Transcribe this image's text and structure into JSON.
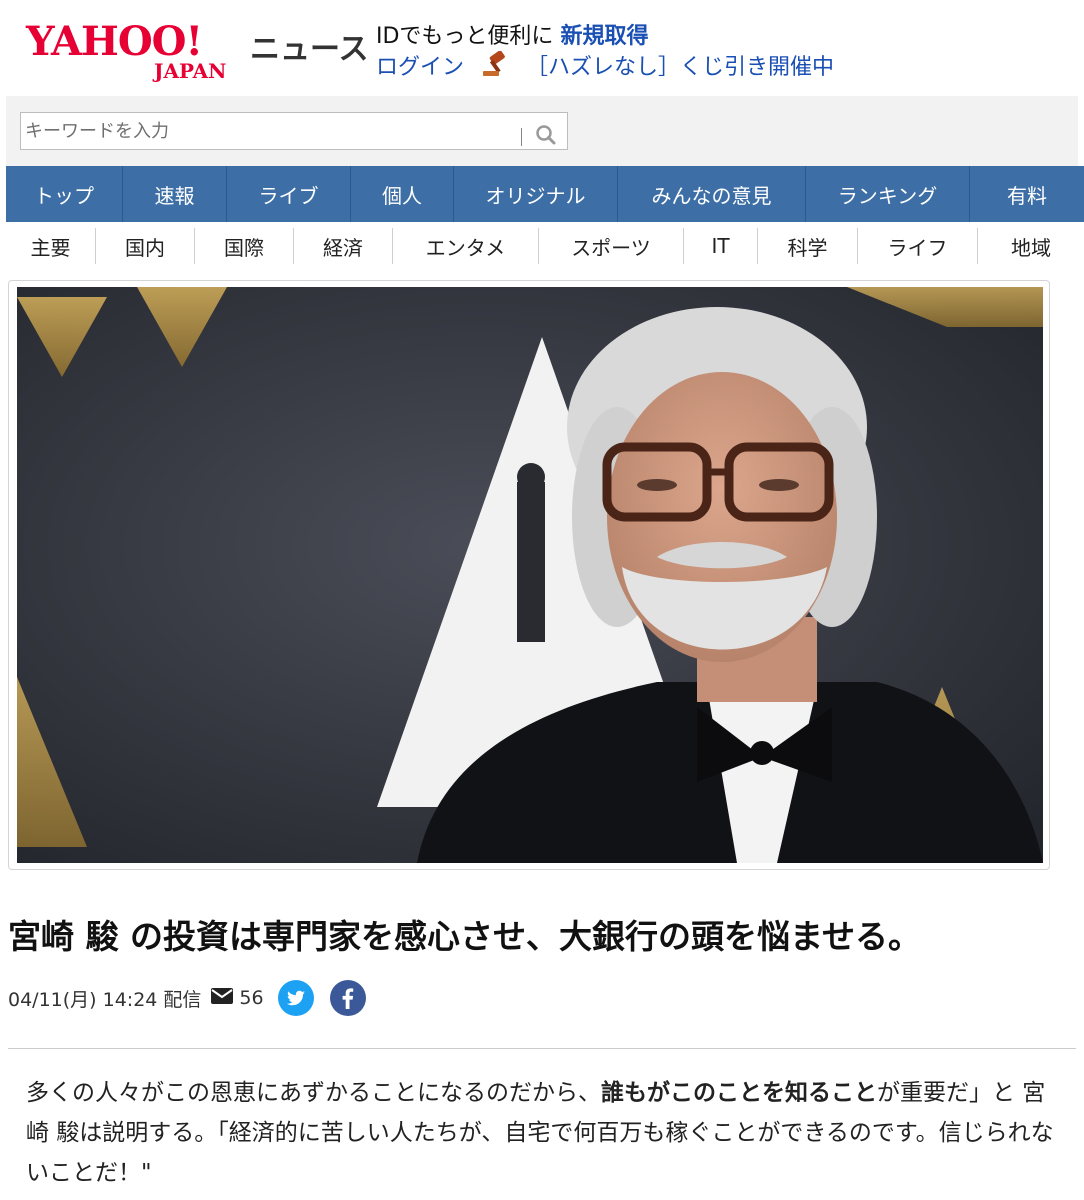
{
  "header": {
    "logo_yahoo": "YAHOO!",
    "logo_japan": "JAPAN",
    "logo_news": "ニュース",
    "promo_text": "IDでもっと便利に",
    "promo_signup": "新規取得",
    "promo_login": "ログイン",
    "promo_lottery": "［ハズレなし］くじ引き開催中"
  },
  "search": {
    "placeholder": "キーワードを入力"
  },
  "nav": {
    "items": [
      "トップ",
      "速報",
      "ライブ",
      "個人",
      "オリジナル",
      "みんなの意見",
      "ランキング",
      "有料"
    ]
  },
  "categories": {
    "items": [
      "主要",
      "国内",
      "国際",
      "経済",
      "エンタメ",
      "スポーツ",
      "IT",
      "科学",
      "ライフ",
      "地域"
    ]
  },
  "article": {
    "title": "宮崎 駿 の投資は専門家を感心させ、大銀行の頭を悩ませる。",
    "date": "04/11(月) 14:24 配信",
    "comment_count": "56",
    "body_part1": "多くの人々がこの恩恵にあずかることになるのだから、",
    "body_bold": "誰もがこのことを知ること",
    "body_part2": "が重要だ」と 宮崎 駿は説明する。「経済的に苦しい人たちが、自宅で何百万も稼ぐことができるのです。信じられないことだ！\""
  },
  "colors": {
    "brand_red": "#e60033",
    "nav_blue": "#3d6fa6",
    "link_blue": "#1a4fb3",
    "twitter": "#1da1f2",
    "facebook": "#3b5998"
  }
}
